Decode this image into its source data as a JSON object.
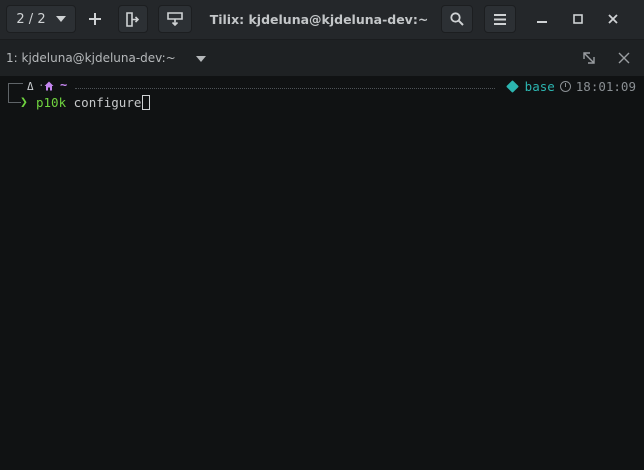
{
  "window": {
    "title": "Tilix: kjdeluna@kjdeluna-dev:~"
  },
  "headerbar": {
    "session_counter": "2 / 2",
    "icons": {
      "add": "plus-icon",
      "split_horizontal": "split-right-icon",
      "split_vertical": "split-down-icon",
      "search": "search-icon",
      "menu": "hamburger-menu-icon",
      "minimize": "minimize-icon",
      "maximize": "maximize-icon",
      "close": "close-icon"
    }
  },
  "terminal_title": {
    "label": "1: kjdeluna@kjdeluna-dev:~",
    "icons": {
      "maximize": "maximize-terminal-icon",
      "close": "close-terminal-icon"
    }
  },
  "prompt": {
    "directory": "~",
    "environment": "base",
    "time": "18:01:09",
    "prompt_char": "❯",
    "command": "p10k",
    "argument": "configure"
  },
  "colors": {
    "headerbar_bg": "#24272a",
    "terminal_bg": "#101213",
    "prompt_green": "#6fd33f",
    "env_teal": "#2cb5b0",
    "dir_purple": "#c586f0"
  }
}
